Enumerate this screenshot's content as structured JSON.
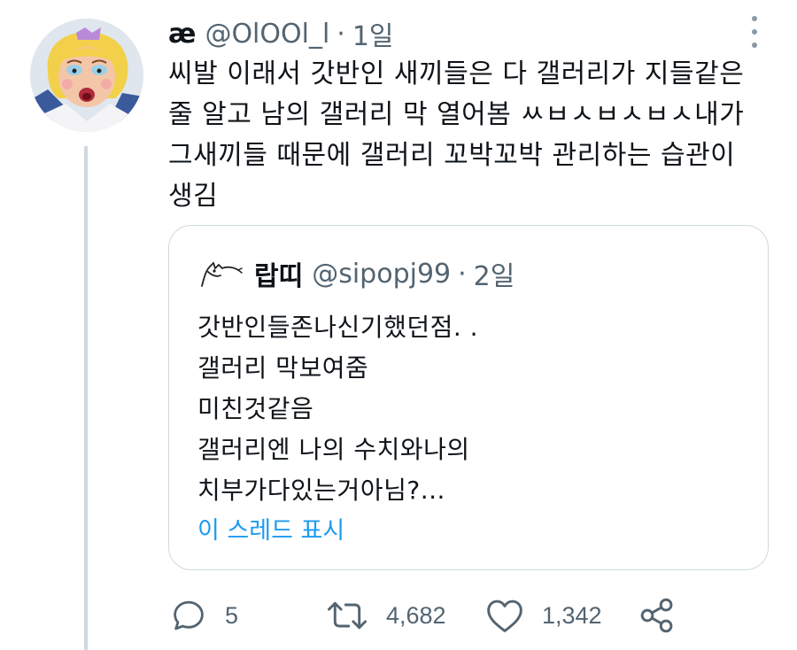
{
  "tweet": {
    "author_name": "æ",
    "author_handle": "@OlOOl_l",
    "separator": "·",
    "time": "1일",
    "text": "씨발 이래서 갓반인 새끼들은 다 갤러리가 지들같은\n줄 알고 남의 갤러리 막 열어봄 ㅆㅂㅅㅂㅅㅂㅅ내가\n그새끼들 때문에 갤러리 꼬박꼬박 관리하는 습관이\n생김",
    "more_icon": "more-dots-icon",
    "avatar_icon": "cartoon-avatar-icon"
  },
  "quote": {
    "author_name": "랍띠",
    "author_handle": "@sipopj99",
    "separator": "·",
    "time": "2일",
    "avatar_icon": "doodle-avatar-icon",
    "text": "갓반인들존나신기했던점. .\n갤러리 막보여줌\n미친것같음\n갤러리엔 나의 수치와나의\n치부가다있는거아님?...",
    "show_thread": "이 스레드 표시"
  },
  "actions": {
    "reply": {
      "icon": "reply-icon",
      "count": "5"
    },
    "retweet": {
      "icon": "retweet-icon",
      "count": "4,682"
    },
    "like": {
      "icon": "heart-icon",
      "count": "1,342"
    },
    "share": {
      "icon": "share-icon"
    }
  },
  "colors": {
    "text": "#0f1419",
    "secondary": "#536471",
    "link": "#1d9bf0",
    "border": "#cfd9de"
  }
}
